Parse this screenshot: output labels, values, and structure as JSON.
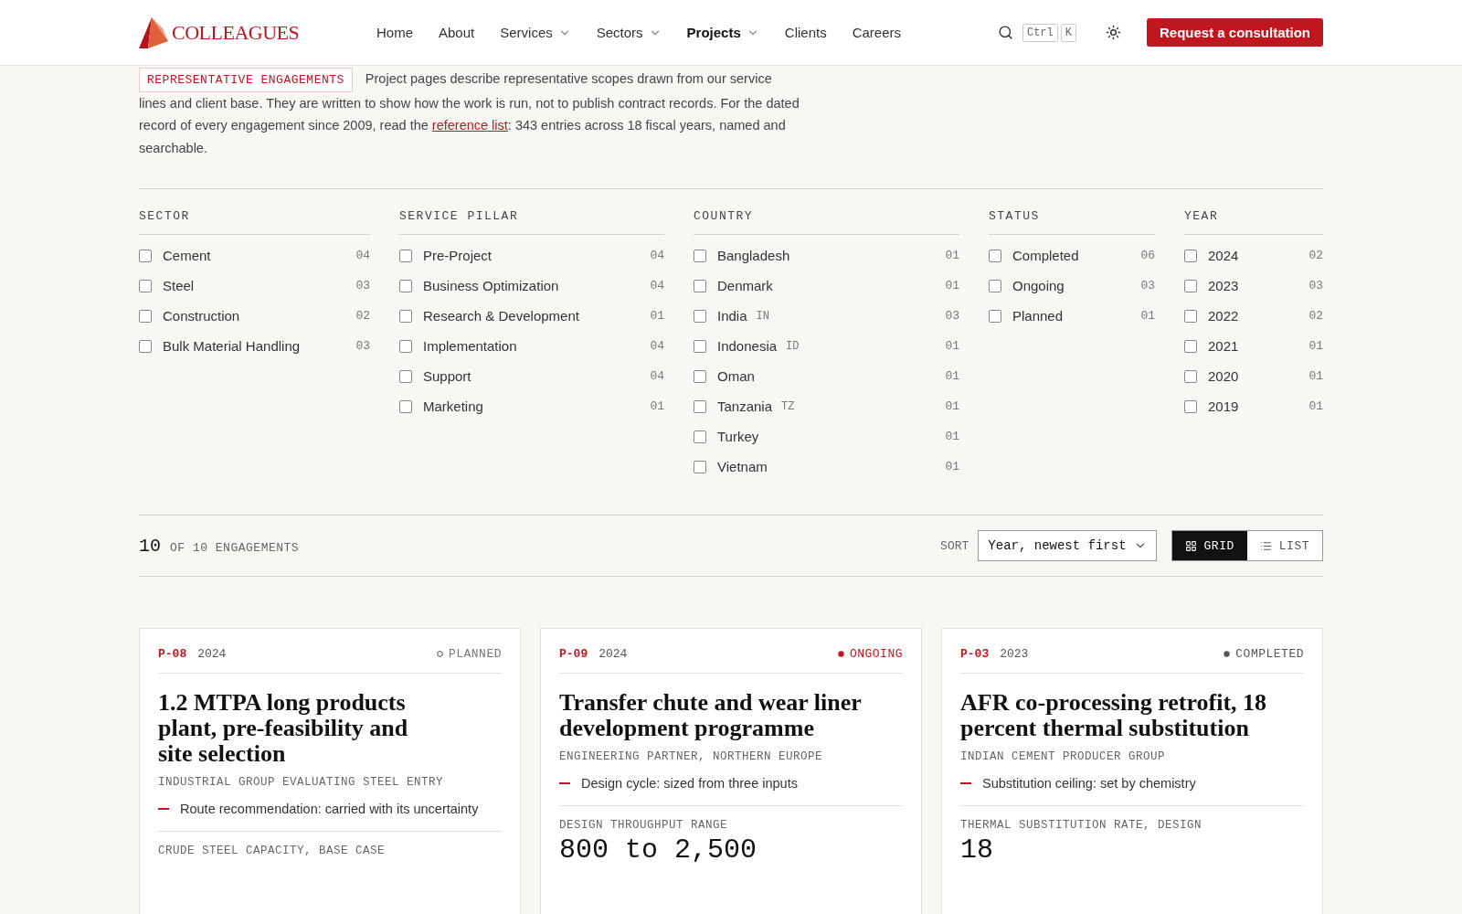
{
  "header": {
    "logo": "COLLEAGUES",
    "nav": [
      {
        "label": "Home",
        "dropdown": false,
        "selected": false
      },
      {
        "label": "About",
        "dropdown": false,
        "selected": false
      },
      {
        "label": "Services",
        "dropdown": true,
        "selected": false
      },
      {
        "label": "Sectors",
        "dropdown": true,
        "selected": false
      },
      {
        "label": "Projects",
        "dropdown": true,
        "selected": true
      },
      {
        "label": "Clients",
        "dropdown": false,
        "selected": false
      },
      {
        "label": "Careers",
        "dropdown": false,
        "selected": false
      }
    ],
    "shortcut": [
      "Ctrl",
      "K"
    ],
    "cta": "Request a consultation"
  },
  "intro": {
    "tag": "REPRESENTATIVE ENGAGEMENTS",
    "before": "Project pages describe representative scopes drawn from our service lines and client base. They are written to show how the work is run, not to publish contract records. For the dated record of every engagement since 2009, read the",
    "link": "reference list",
    "after": ": 343 entries across 18 fiscal years, named and searchable."
  },
  "filters": [
    {
      "heading": "SECTOR",
      "options": [
        {
          "label": "Cement",
          "count": "04",
          "checked": false
        },
        {
          "label": "Steel",
          "count": "03",
          "checked": false
        },
        {
          "label": "Construction",
          "count": "02",
          "checked": false
        },
        {
          "label": "Bulk Material Handling",
          "count": "03",
          "checked": false
        }
      ]
    },
    {
      "heading": "SERVICE PILLAR",
      "options": [
        {
          "label": "Pre-Project",
          "count": "04",
          "checked": false
        },
        {
          "label": "Business Optimization",
          "count": "04",
          "checked": false
        },
        {
          "label": "Research & Development",
          "count": "01",
          "checked": false
        },
        {
          "label": "Implementation",
          "count": "04",
          "checked": false
        },
        {
          "label": "Support",
          "count": "04",
          "checked": false
        },
        {
          "label": "Marketing",
          "count": "01",
          "checked": false
        }
      ]
    },
    {
      "heading": "COUNTRY",
      "options": [
        {
          "label": "Bangladesh",
          "count": "01",
          "checked": false
        },
        {
          "label": "Denmark",
          "count": "01",
          "checked": false
        },
        {
          "label": "India",
          "code": "IN",
          "count": "03",
          "checked": false
        },
        {
          "label": "Indonesia",
          "code": "ID",
          "count": "01",
          "checked": false
        },
        {
          "label": "Oman",
          "count": "01",
          "checked": false
        },
        {
          "label": "Tanzania",
          "code": "TZ",
          "count": "01",
          "checked": false
        },
        {
          "label": "Turkey",
          "count": "01",
          "checked": false
        },
        {
          "label": "Vietnam",
          "count": "01",
          "checked": false
        }
      ]
    },
    {
      "heading": "STATUS",
      "options": [
        {
          "label": "Completed",
          "count": "06",
          "checked": false
        },
        {
          "label": "Ongoing",
          "count": "03",
          "checked": false
        },
        {
          "label": "Planned",
          "count": "01",
          "checked": false
        }
      ]
    },
    {
      "heading": "YEAR",
      "options": [
        {
          "label": "2024",
          "count": "02",
          "checked": false
        },
        {
          "label": "2023",
          "count": "03",
          "checked": false
        },
        {
          "label": "2022",
          "count": "02",
          "checked": false
        },
        {
          "label": "2021",
          "count": "01",
          "checked": false
        },
        {
          "label": "2020",
          "count": "01",
          "checked": false
        },
        {
          "label": "2019",
          "count": "01",
          "checked": false
        }
      ]
    }
  ],
  "results": {
    "count": "10",
    "of": "OF 10 ENGAGEMENTS",
    "sort_label": "SORT",
    "sort_value": "Year, newest first",
    "views": [
      {
        "label": "GRID",
        "kind": "grid",
        "selected": true
      },
      {
        "label": "LIST",
        "kind": "list",
        "selected": false
      }
    ]
  },
  "cards": [
    {
      "id": "P-08",
      "year": "2024",
      "status": "PLANNED",
      "kind": "planned",
      "title": "1.2 MTPA long products plant, pre-feasibility and site selection",
      "client": "INDUSTRIAL GROUP EVALUATING STEEL ENTRY",
      "point": "Route recommendation: carried with its uncertainty",
      "metric_label": "CRUDE STEEL CAPACITY, BASE CASE"
    },
    {
      "id": "P-09",
      "year": "2024",
      "status": "ONGOING",
      "kind": "ongoing",
      "title": "Transfer chute and wear liner development programme",
      "client": "ENGINEERING PARTNER, NORTHERN EUROPE",
      "point": "Design cycle: sized from three inputs",
      "metric_label": "DESIGN THROUGHPUT RANGE",
      "metric_value": "800 to 2,500"
    },
    {
      "id": "P-03",
      "year": "2023",
      "status": "COMPLETED",
      "kind": "completed",
      "title": "AFR co-processing retrofit, 18 percent thermal substitution",
      "client": "INDIAN CEMENT PRODUCER GROUP",
      "point": "Substitution ceiling: set by chemistry",
      "metric_label": "THERMAL SUBSTITUTION RATE, DESIGN",
      "metric_value": "18"
    }
  ]
}
